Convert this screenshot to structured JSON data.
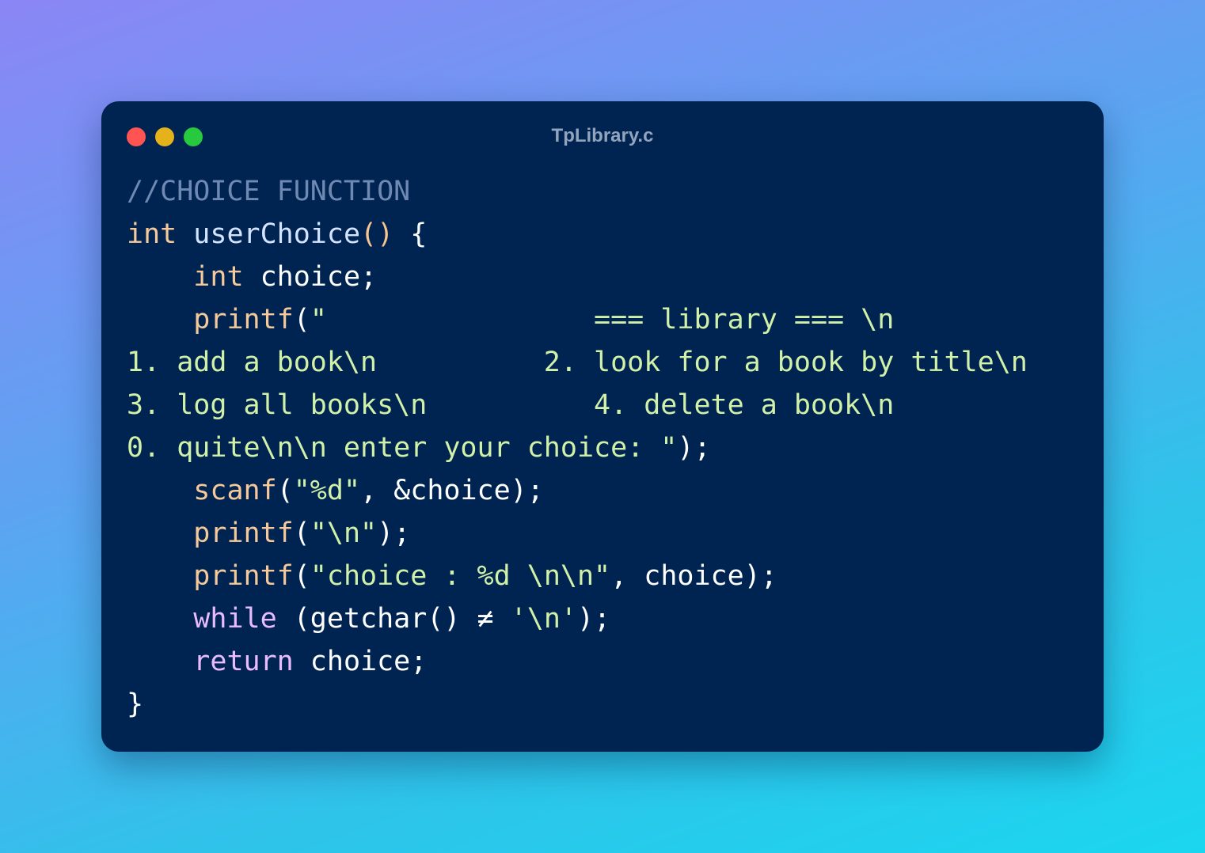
{
  "window": {
    "title": "TpLibrary.c",
    "traffic_lights": [
      "close",
      "minimize",
      "maximize"
    ],
    "colors": {
      "background": "#002451",
      "close": "#ff5452",
      "minimize": "#e5b21b",
      "maximize": "#27c93f"
    }
  },
  "code": {
    "language": "c",
    "lines": [
      [
        {
          "t": "//CHOICE FUNCTION",
          "c": "cm"
        }
      ],
      [
        {
          "t": "int",
          "c": "kw"
        },
        {
          "t": " ",
          "c": "id"
        },
        {
          "t": "userChoice",
          "c": "fn"
        },
        {
          "t": "()",
          "c": "pn"
        },
        {
          "t": " {",
          "c": "id"
        }
      ],
      [
        {
          "t": "    ",
          "c": "id"
        },
        {
          "t": "int",
          "c": "kw"
        },
        {
          "t": " choice;",
          "c": "id"
        }
      ],
      [
        {
          "t": "    ",
          "c": "id"
        },
        {
          "t": "printf",
          "c": "kw"
        },
        {
          "t": "(",
          "c": "id"
        },
        {
          "t": "\"                === library === \\n",
          "c": "str"
        }
      ],
      [
        {
          "t": "1. add a book\\n          2. look for a book by title\\n",
          "c": "str"
        }
      ],
      [
        {
          "t": "3. log all books\\n          4. delete a book\\n",
          "c": "str"
        }
      ],
      [
        {
          "t": "0. quite\\n\\n enter your choice: \"",
          "c": "str"
        },
        {
          "t": ");",
          "c": "id"
        }
      ],
      [
        {
          "t": "    ",
          "c": "id"
        },
        {
          "t": "scanf",
          "c": "kw"
        },
        {
          "t": "(",
          "c": "id"
        },
        {
          "t": "\"%d\"",
          "c": "str"
        },
        {
          "t": ", &choice);",
          "c": "id"
        }
      ],
      [
        {
          "t": "    ",
          "c": "id"
        },
        {
          "t": "printf",
          "c": "kw"
        },
        {
          "t": "(",
          "c": "id"
        },
        {
          "t": "\"\\n\"",
          "c": "str"
        },
        {
          "t": ");",
          "c": "id"
        }
      ],
      [
        {
          "t": "    ",
          "c": "id"
        },
        {
          "t": "printf",
          "c": "kw"
        },
        {
          "t": "(",
          "c": "id"
        },
        {
          "t": "\"choice : %d \\n\\n\"",
          "c": "str"
        },
        {
          "t": ", choice);",
          "c": "id"
        }
      ],
      [
        {
          "t": "    ",
          "c": "id"
        },
        {
          "t": "while",
          "c": "ctl"
        },
        {
          "t": " (getchar() ≠ ",
          "c": "id"
        },
        {
          "t": "'\\n'",
          "c": "str"
        },
        {
          "t": ");",
          "c": "id"
        }
      ],
      [
        {
          "t": "    ",
          "c": "id"
        },
        {
          "t": "return",
          "c": "ctl"
        },
        {
          "t": " choice;",
          "c": "id"
        }
      ],
      [
        {
          "t": "}",
          "c": "id"
        }
      ]
    ]
  }
}
